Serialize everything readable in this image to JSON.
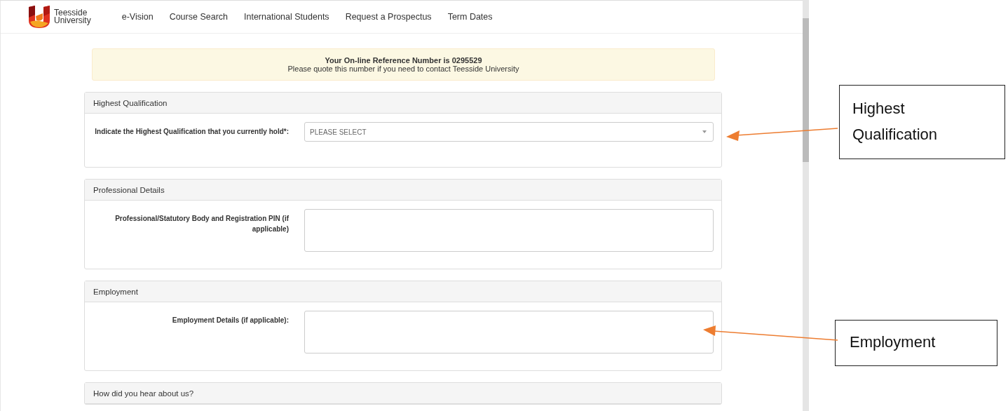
{
  "logo": {
    "line1": "Teesside",
    "line2": "University"
  },
  "nav": [
    {
      "label": "e-Vision"
    },
    {
      "label": "Course Search"
    },
    {
      "label": "International Students"
    },
    {
      "label": "Request a Prospectus"
    },
    {
      "label": "Term Dates"
    }
  ],
  "notice": {
    "title": "Your On-line Reference Number is 0295529",
    "text": "Please quote this number if you need to contact Teesside University"
  },
  "sections": [
    {
      "title": "Highest Qualification",
      "field": {
        "kind": "select",
        "label": "Indicate the Highest Qualification that you currently hold*:",
        "placeholder": "PLEASE SELECT"
      }
    },
    {
      "title": "Professional Details",
      "field": {
        "kind": "textarea",
        "label": "Professional/Statutory Body and Registration PIN (if applicable)"
      }
    },
    {
      "title": "Employment",
      "field": {
        "kind": "textarea",
        "label": "Employment Details (if applicable):"
      }
    },
    {
      "title": "How did you hear about us?"
    }
  ],
  "annotations": [
    {
      "text": "Highest Qualification"
    },
    {
      "text": "Employment"
    }
  ]
}
